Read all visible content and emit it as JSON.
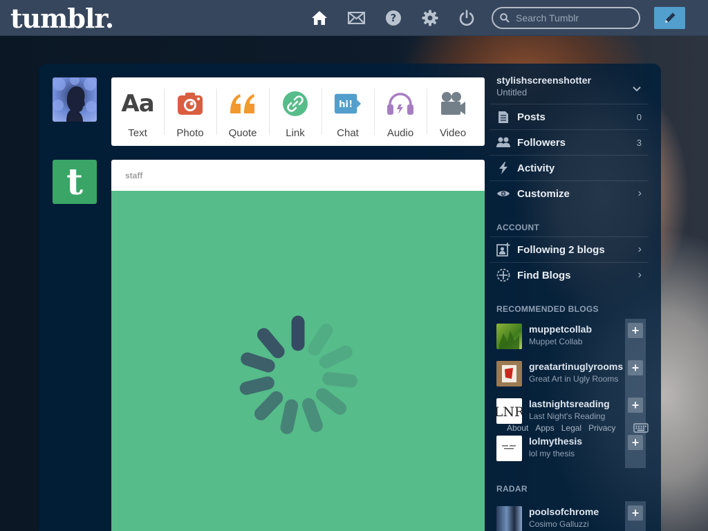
{
  "topbar": {
    "logo": "tumblr.",
    "search_placeholder": "Search Tumblr"
  },
  "post_types": [
    {
      "label": "Text",
      "icon": "text-icon",
      "glyph": "Aa",
      "color": "#444444"
    },
    {
      "label": "Photo",
      "icon": "camera-icon",
      "color": "#d95e40"
    },
    {
      "label": "Quote",
      "icon": "quote-icon",
      "glyph": "“",
      "color": "#f2992e"
    },
    {
      "label": "Link",
      "icon": "link-icon",
      "color": "#56bc8a"
    },
    {
      "label": "Chat",
      "icon": "chat-icon",
      "glyph": "hi!",
      "color": "#529ecc"
    },
    {
      "label": "Audio",
      "icon": "headphones-icon",
      "color": "#a77dc2"
    },
    {
      "label": "Video",
      "icon": "video-camera-icon",
      "color": "#748089"
    }
  ],
  "post": {
    "author": "staff",
    "body_color": "#56bc8a"
  },
  "sidebar": {
    "blog_name": "stylishscreenshotter",
    "blog_title": "Untitled",
    "rows": [
      {
        "label": "Posts",
        "count": "0"
      },
      {
        "label": "Followers",
        "count": "3"
      },
      {
        "label": "Activity",
        "count": ""
      },
      {
        "label": "Customize",
        "count": ""
      }
    ],
    "account_label": "ACCOUNT",
    "account_rows": [
      {
        "label": "Following 2 blogs"
      },
      {
        "label": "Find Blogs"
      }
    ],
    "recommended_label": "RECOMMENDED BLOGS",
    "recommended": [
      {
        "name": "muppetcollab",
        "title": "Muppet Collab"
      },
      {
        "name": "greatartinuglyrooms",
        "title": "Great Art in Ugly Rooms"
      },
      {
        "name": "lastnightsreading",
        "title": "Last Night's Reading"
      },
      {
        "name": "lolmythesis",
        "title": "lol my thesis"
      }
    ],
    "radar_label": "RADAR",
    "radar": [
      {
        "name": "poolsofchrome",
        "title": "Cosimo Galluzzi"
      }
    ],
    "footer_links": [
      "About",
      "Apps",
      "Legal",
      "Privacy"
    ]
  },
  "colors": {
    "topbar": "#36465d",
    "compose": "#529ecc",
    "dashboard": "#001f3b"
  }
}
